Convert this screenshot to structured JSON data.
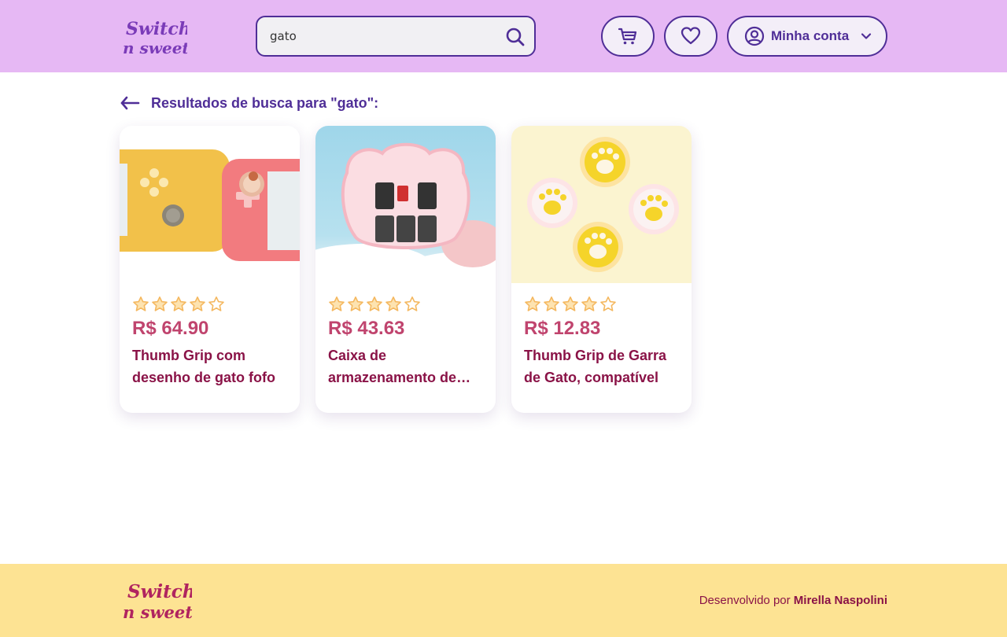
{
  "header": {
    "logo_text": "Switch n sweet",
    "search": {
      "value": "gato",
      "placeholder": ""
    },
    "account_label": "Minha conta"
  },
  "results": {
    "title": "Resultados de busca para \"gato\":"
  },
  "products": [
    {
      "rating": 4,
      "price": "R$ 64.90",
      "title": "Thumb Grip com desenho de gato fofo"
    },
    {
      "rating": 4,
      "price": "R$ 43.63",
      "title": "Caixa de armazenamento de jogos"
    },
    {
      "rating": 4,
      "price": "R$ 12.83",
      "title": "Thumb Grip de Garra de Gato, compatível"
    }
  ],
  "footer": {
    "logo_text": "Switch n sweet",
    "credit_prefix": "Desenvolvido por",
    "credit_author": "Mirella Naspolini"
  },
  "colors": {
    "header_bg": "#e6b8f4",
    "accent_purple": "#4f2e97",
    "price_pink": "#c0446e",
    "title_wine": "#8a1347",
    "footer_bg": "#fde393",
    "star": "#f4b860"
  },
  "icons": [
    "search-icon",
    "cart-icon",
    "heart-icon",
    "user-icon",
    "chevron-down-icon",
    "arrow-left-icon",
    "star-icon"
  ]
}
